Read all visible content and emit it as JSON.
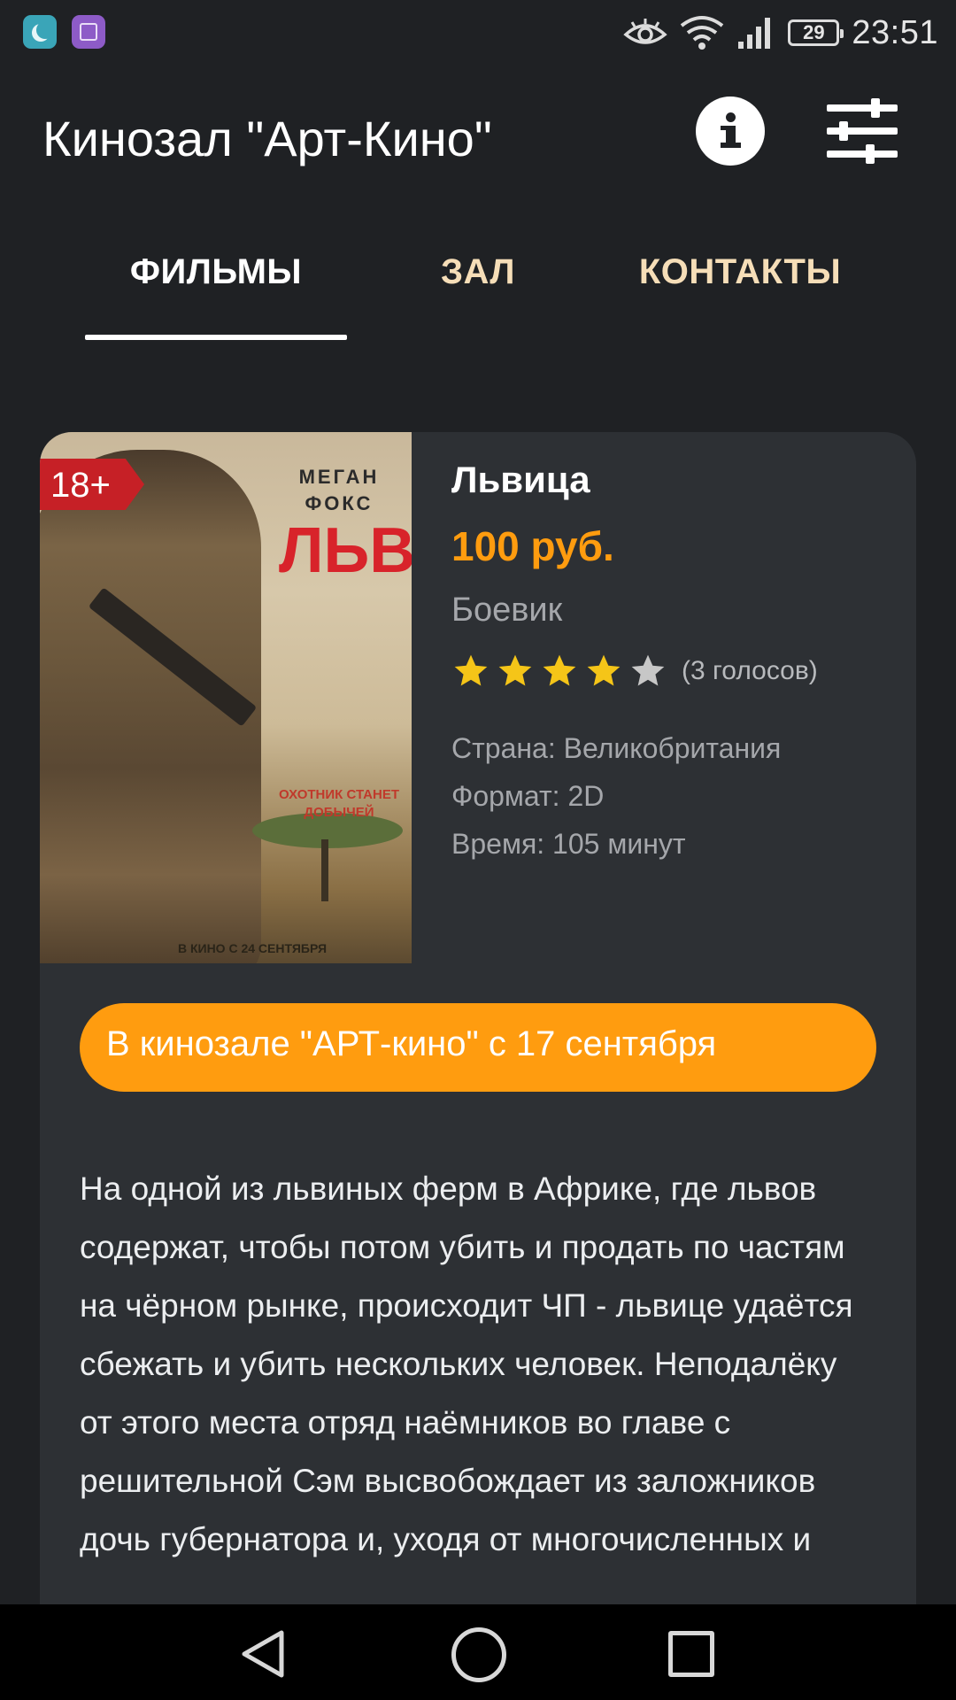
{
  "status_bar": {
    "time": "23:51",
    "battery": "29"
  },
  "app_bar": {
    "title": "Кинозал \"Арт-Кино\""
  },
  "tabs": [
    {
      "label": "ФИЛЬМЫ",
      "active": true
    },
    {
      "label": "ЗАЛ",
      "active": false
    },
    {
      "label": "КОНТАКТЫ",
      "active": false
    }
  ],
  "movie": {
    "age_rating": "18+",
    "poster": {
      "cast": "МЕГАН ФОКС",
      "title": "ЛЬВИЦА",
      "tagline": "ОХОТНИК СТАНЕТ ДОБЫЧЕЙ",
      "release": "В КИНО С 24 СЕНТЯБРЯ"
    },
    "title": "Львица",
    "price": "100 руб.",
    "genre": "Боевик",
    "rating": 4,
    "rating_max": 5,
    "votes": "(3 голосов)",
    "country": "Страна: Великобритания",
    "format": "Формат: 2D",
    "duration": "Время: 105 минут",
    "showing": "В кинозале \"АРТ-кино\" с 17 сентября",
    "description": "На одной из львиных ферм в Африке, где львов содержат, чтобы потом убить и продать по частям на чёрном рынке, происходит ЧП - львице удаётся сбежать и убить нескольких человек. Неподалёку от этого места отряд наёмников во главе с решительной Сэм высвобождает из заложников дочь губернатора и, уходя от многочисленных и"
  },
  "colors": {
    "background": "#1f2124",
    "card": "#2d3034",
    "accent": "#ff9c0f",
    "tab_inactive": "#f6deb8",
    "badge": "#c62026",
    "star_on": "#f5c518",
    "star_off": "#c7c7c7"
  }
}
